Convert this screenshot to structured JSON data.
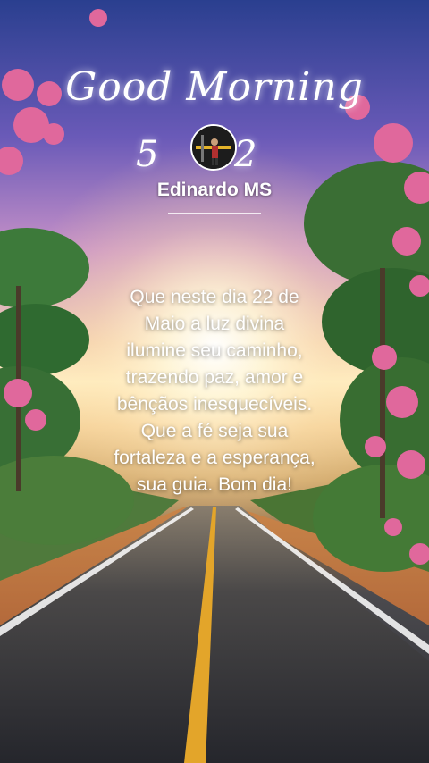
{
  "greeting": {
    "title": "Good Morning",
    "date_left": "5",
    "date_right": "2"
  },
  "profile": {
    "username": "Edinardo MS"
  },
  "message": {
    "text": "Que neste dia 22 de\nMaio a luz divina\nilumine seu caminho,\ntrazendo paz, amor e\nbênçãos inesquecíveis.\nQue a fé seja sua\nfortaleza e a esperança,\nsua guia. Bom dia!"
  },
  "colors": {
    "sky_top": "#2a3f8f",
    "sun_glow": "#fff2c6",
    "road": "#2b2c33",
    "center_line": "#e3a52a",
    "blossom": "#e0689c",
    "foliage": "#3d7a3a"
  }
}
